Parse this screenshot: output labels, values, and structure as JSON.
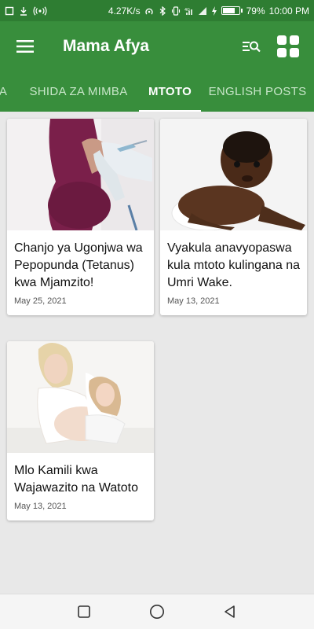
{
  "status_bar": {
    "speed": "4.27K/s",
    "battery_percent": "79%",
    "battery_level": 0.79,
    "time": "10:00 PM"
  },
  "app_bar": {
    "title": "Mama Afya",
    "menu_icon": "hamburger-menu-icon",
    "search_icon": "list-search-icon",
    "grid_icon": "grid-view-icon",
    "color": "#388e3c"
  },
  "tabs": [
    {
      "label": "A",
      "active": false
    },
    {
      "label": "SHIDA ZA MIMBA",
      "active": false
    },
    {
      "label": "MTOTO",
      "active": true
    },
    {
      "label": "ENGLISH POSTS",
      "active": false
    }
  ],
  "posts": [
    {
      "title": "Chanjo ya Ugonjwa wa Pepopunda (Tetanus) kwa Mjamzito!",
      "date": "May 25, 2021",
      "image": "pregnant-woman-vaccination"
    },
    {
      "title": "Vyakula anavyopaswa kula mtoto kulingana na Umri Wake.",
      "date": "May 13, 2021",
      "image": "baby-crawling"
    },
    {
      "title": "Mlo Kamili kwa Wajawazito na Watoto",
      "date": "May 13, 2021",
      "image": "pregnant-mother-with-child"
    }
  ],
  "nav_bar": {
    "recents_icon": "square-recents-icon",
    "home_icon": "circle-home-icon",
    "back_icon": "triangle-back-icon"
  }
}
